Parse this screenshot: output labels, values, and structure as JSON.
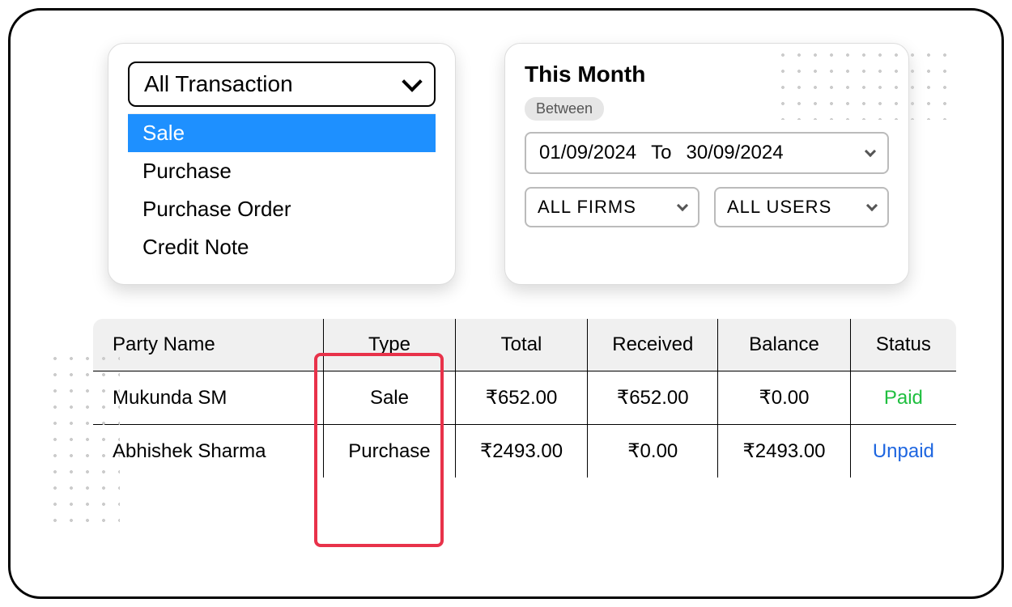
{
  "transaction_filter": {
    "selected": "All Transaction",
    "options": [
      "Sale",
      "Purchase",
      "Purchase Order",
      "Credit Note"
    ]
  },
  "date_panel": {
    "title": "This Month",
    "badge": "Between",
    "from": "01/09/2024",
    "to_word": "To",
    "to": "30/09/2024",
    "firms": "ALL FIRMS",
    "users": "ALL USERS"
  },
  "table": {
    "headers": [
      "Party Name",
      "Type",
      "Total",
      "Received",
      "Balance",
      "Status"
    ],
    "rows": [
      {
        "party": "Mukunda SM",
        "type": "Sale",
        "total": "₹652.00",
        "received": "₹652.00",
        "balance": "₹0.00",
        "status": "Paid",
        "status_class": "paid"
      },
      {
        "party": "Abhishek Sharma",
        "type": "Purchase",
        "total": "₹2493.00",
        "received": "₹0.00",
        "balance": "₹2493.00",
        "status": "Unpaid",
        "status_class": "unpaid"
      }
    ]
  }
}
